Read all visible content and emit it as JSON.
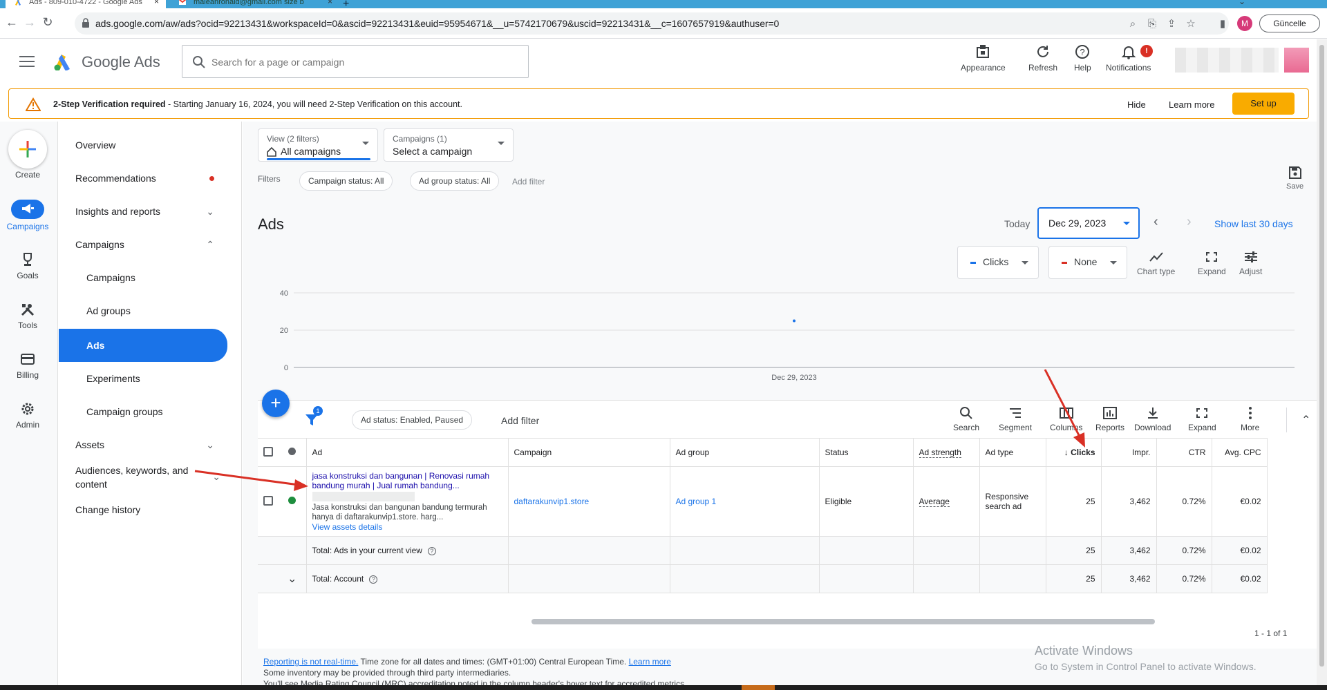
{
  "browser": {
    "tabs": [
      {
        "title": "Ads - 809-010-4722 - Google Ads",
        "active": true
      },
      {
        "title": "maleanronald@gmail.com size b",
        "active": false
      }
    ],
    "url": "ads.google.com/aw/ads?ocid=92213431&workspaceId=0&ascid=92213431&euid=95954671&__u=5742170679&uscid=92213431&__c=1607657919&authuser=0",
    "profile_initial": "M",
    "update_label": "Güncelle"
  },
  "header": {
    "product_name": "Google Ads",
    "search_placeholder": "Search for a page or campaign",
    "actions": [
      {
        "label": "Appearance",
        "icon": "appearance-icon"
      },
      {
        "label": "Refresh",
        "icon": "refresh-icon"
      },
      {
        "label": "Help",
        "icon": "help-icon"
      },
      {
        "label": "Notifications",
        "icon": "bell-icon",
        "badge": "!"
      }
    ]
  },
  "banner": {
    "title": "2-Step Verification required",
    "message": " - Starting January 16, 2024, you will need 2-Step Verification on this account.",
    "hide_label": "Hide",
    "learn_label": "Learn more",
    "setup_label": "Set up",
    "accent": "#f9ab00"
  },
  "rail": {
    "create_label": "Create",
    "items": [
      {
        "label": "Campaigns",
        "icon": "megaphone-icon",
        "active": true
      },
      {
        "label": "Goals",
        "icon": "trophy-icon"
      },
      {
        "label": "Tools",
        "icon": "tools-icon"
      },
      {
        "label": "Billing",
        "icon": "card-icon"
      },
      {
        "label": "Admin",
        "icon": "gear-icon"
      }
    ]
  },
  "sidenav": {
    "items": [
      {
        "label": "Overview"
      },
      {
        "label": "Recommendations",
        "dot": true
      },
      {
        "label": "Insights and reports",
        "chevron": "down"
      },
      {
        "label": "Campaigns",
        "chevron": "up"
      },
      {
        "label": "Campaigns",
        "sub": true
      },
      {
        "label": "Ad groups",
        "sub": true
      },
      {
        "label": "Ads",
        "sub": true,
        "active": true
      },
      {
        "label": "Experiments",
        "sub": true
      },
      {
        "label": "Campaign groups",
        "sub": true
      },
      {
        "label": "Assets",
        "chevron": "down"
      },
      {
        "label": "Audiences, keywords, and content",
        "chevron": "down"
      },
      {
        "label": "Change history"
      }
    ]
  },
  "main": {
    "view_dd": {
      "label": "View (2 filters)",
      "value": "All campaigns"
    },
    "campaign_dd": {
      "label": "Campaigns (1)",
      "value": "Select a campaign"
    },
    "filters_label": "Filters",
    "filter_chips": [
      "Campaign status: All",
      "Ad group status: All"
    ],
    "add_filter": "Add filter",
    "save_label": "Save",
    "title": "Ads",
    "today_label": "Today",
    "date_value": "Dec 29, 2023",
    "show_last": "Show last 30 days",
    "primary_color": "#1a73e8"
  },
  "chart_controls": {
    "metric1": {
      "label": "Clicks",
      "color": "#1a73e8"
    },
    "metric2": {
      "label": "None",
      "color": "#d93025"
    },
    "tools": [
      "Chart type",
      "Expand",
      "Adjust"
    ]
  },
  "chart_data": {
    "type": "line",
    "x": [
      "Dec 29, 2023"
    ],
    "series": [
      {
        "name": "Clicks",
        "values": [
          25
        ],
        "color": "#1a73e8"
      }
    ],
    "yticks": [
      0,
      20,
      40
    ],
    "ylim": [
      0,
      40
    ],
    "xlabel": "",
    "ylabel": "",
    "title": "",
    "grid": true
  },
  "table": {
    "toolbar": {
      "filter_count": "1",
      "chip": "Ad status: Enabled, Paused",
      "add_filter": "Add filter",
      "tools": [
        "Search",
        "Segment",
        "Columns",
        "Reports",
        "Download",
        "Expand",
        "More"
      ]
    },
    "columns": [
      "Ad",
      "Campaign",
      "Ad group",
      "Status",
      "Ad strength",
      "Ad type",
      "Clicks",
      "Impr.",
      "CTR",
      "Avg. CPC"
    ],
    "sort_arrow": "↓",
    "row": {
      "ad_headline": "jasa konstruksi dan bangunan | Renovasi rumah bandung murah | Jual rumah bandung...",
      "ad_desc": "Jasa konstruksi dan bangunan bandung termurah hanya di daftarakunvip1.store. harg...",
      "view_assets": "View assets details",
      "campaign": "daftarakunvip1.store",
      "ad_group": "Ad group 1",
      "status": "Eligible",
      "ad_strength": "Average",
      "ad_type": "Responsive search ad",
      "clicks": "25",
      "impr": "3,462",
      "ctr": "0.72%",
      "avg_cpc": "€0.02",
      "status_color": "#1e8e3e"
    },
    "totals": [
      {
        "label": "Total: Ads in your current view",
        "clicks": "25",
        "impr": "3,462",
        "ctr": "0.72%",
        "avg_cpc": "€0.02"
      },
      {
        "label": "Total: Account",
        "clicks": "25",
        "impr": "3,462",
        "ctr": "0.72%",
        "avg_cpc": "€0.02"
      }
    ],
    "pager": "1 - 1 of 1"
  },
  "footer": {
    "link1": "Reporting is not real-time.",
    "text1": " Time zone for all dates and times: (GMT+01:00) Central European Time. ",
    "link2": "Learn more",
    "line2": "Some inventory may be provided through third party intermediaries.",
    "line3": "You'll see Media Rating Council (MRC) accreditation noted in the column header's hover text for accredited metrics."
  },
  "watermark": {
    "line1": "Activate Windows",
    "line2": "Go to System in Control Panel to activate Windows."
  }
}
